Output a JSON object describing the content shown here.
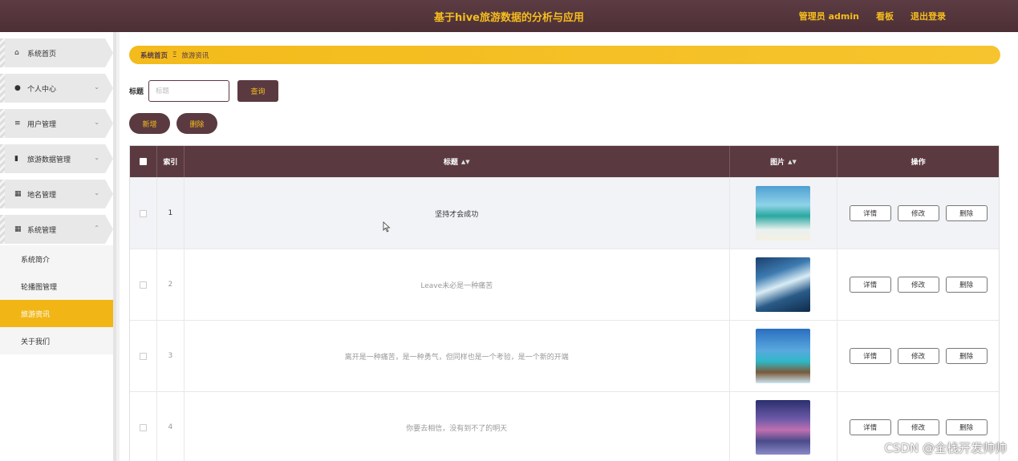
{
  "header": {
    "title": "基于hive旅游数据的分析与应用",
    "user": "管理员 admin",
    "dashboard": "看板",
    "logout": "退出登录",
    "accent": "#f5bd1e",
    "bg": "#4c2f35"
  },
  "sidebar": {
    "items": [
      {
        "label": "系统首页",
        "icon": "home-icon"
      },
      {
        "label": "个人中心",
        "icon": "user-icon"
      },
      {
        "label": "用户管理",
        "icon": "list-icon"
      },
      {
        "label": "旅游数据管理",
        "icon": "book-icon"
      },
      {
        "label": "地名管理",
        "icon": "grid-icon"
      },
      {
        "label": "系统管理",
        "icon": "grid-icon"
      }
    ],
    "subitems": [
      {
        "label": "系统简介"
      },
      {
        "label": "轮播图管理"
      },
      {
        "label": "旅游资讯",
        "active": true
      },
      {
        "label": "关于我们"
      }
    ]
  },
  "breadcrumb": {
    "home": "系统首页",
    "separator": "Ξ",
    "current": "旅游资讯"
  },
  "search": {
    "label": "标题",
    "placeholder": "标题",
    "value": "",
    "button": "查询"
  },
  "actions": {
    "add": "新增",
    "delete": "删除"
  },
  "table": {
    "headers": {
      "index": "索引",
      "title": "标题",
      "image": "图片",
      "ops": "操作"
    },
    "rows": [
      {
        "index": "1",
        "title": "坚持才会成功"
      },
      {
        "index": "2",
        "title": "Leave未必是一种痛苦"
      },
      {
        "index": "3",
        "title": "离开是一种痛苦，是一种勇气，但同样也是一个考验，是一个新的开端"
      },
      {
        "index": "4",
        "title": "你要去相信，没有到不了的明天"
      }
    ],
    "op_labels": {
      "detail": "详情",
      "edit": "修改",
      "delete": "删除"
    }
  },
  "watermark": "CSDN @全栈开发帅帅"
}
